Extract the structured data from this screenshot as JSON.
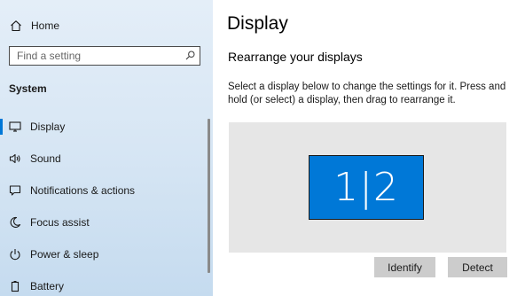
{
  "sidebar": {
    "home": {
      "label": "Home",
      "icon": "home-icon"
    },
    "search": {
      "placeholder": "Find a setting",
      "value": "",
      "icon": "search-icon"
    },
    "section_title": "System",
    "items": [
      {
        "label": "Display",
        "icon": "monitor-icon",
        "selected": true
      },
      {
        "label": "Sound",
        "icon": "speaker-icon",
        "selected": false
      },
      {
        "label": "Notifications & actions",
        "icon": "notification-icon",
        "selected": false
      },
      {
        "label": "Focus assist",
        "icon": "moon-icon",
        "selected": false
      },
      {
        "label": "Power & sleep",
        "icon": "power-icon",
        "selected": false
      },
      {
        "label": "Battery",
        "icon": "battery-icon",
        "selected": false
      }
    ]
  },
  "main": {
    "title": "Display",
    "heading": "Rearrange your displays",
    "description": "Select a display below to change the settings for it. Press and hold (or select) a display, then drag to rearrange it.",
    "monitor_label": "1|2",
    "identify_label": "Identify",
    "detect_label": "Detect"
  },
  "colors": {
    "accent": "#0078d7",
    "sidebar_background": "#d7e6f4",
    "display_area_background": "#e6e6e6",
    "button_background": "#cccccc"
  }
}
